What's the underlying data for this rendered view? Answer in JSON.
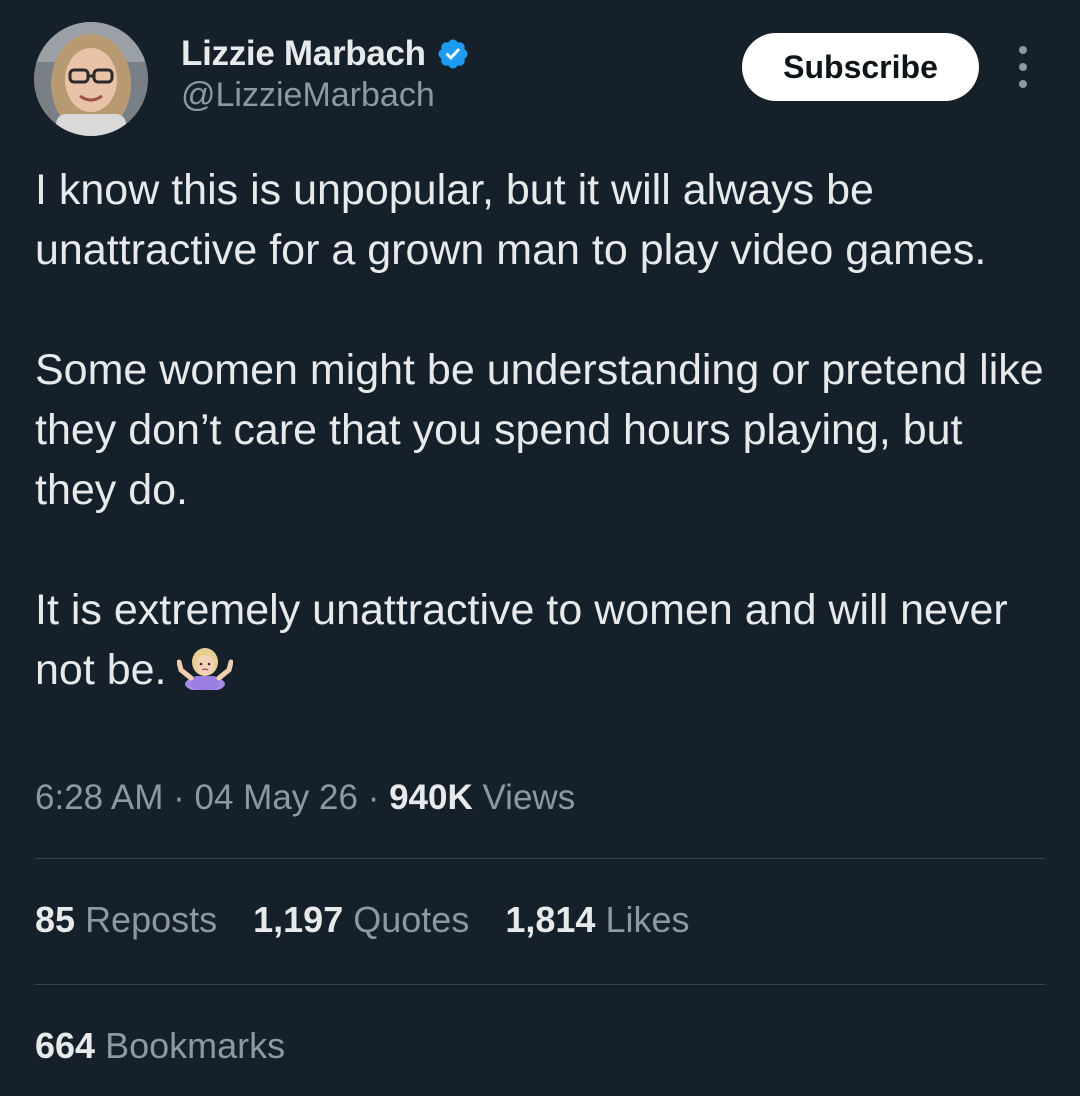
{
  "author": {
    "display_name": "Lizzie Marbach",
    "handle": "@LizzieMarbach",
    "verified_icon": "verified-badge-icon",
    "avatar_icon": "profile-avatar"
  },
  "header": {
    "subscribe_label": "Subscribe",
    "more_icon": "more-vertical-icon"
  },
  "tweet": {
    "paragraphs": [
      "I know this is unpopular, but it will always be unattractive for a grown man to play video games.",
      "Some women might be understanding or pretend like they don’t care that you spend hours playing, but they do.",
      "It is extremely unattractive to women and will never not be."
    ],
    "emoji": "person-shrugging-emoji"
  },
  "meta": {
    "time": "6:28 AM",
    "sep1": " · ",
    "date": "04 May 26",
    "sep2": " · ",
    "views_count": "940K",
    "views_label": " Views"
  },
  "stats": {
    "reposts_count": "85",
    "reposts_label": "Reposts",
    "quotes_count": "1,197",
    "quotes_label": "Quotes",
    "likes_count": "1,814",
    "likes_label": "Likes",
    "bookmarks_count": "664",
    "bookmarks_label": "Bookmarks"
  },
  "colors": {
    "background": "#15202b",
    "text_primary": "#e7e9ea",
    "text_secondary": "#8b98a5",
    "divider": "#38444d",
    "verified_blue": "#1d9bf0"
  }
}
